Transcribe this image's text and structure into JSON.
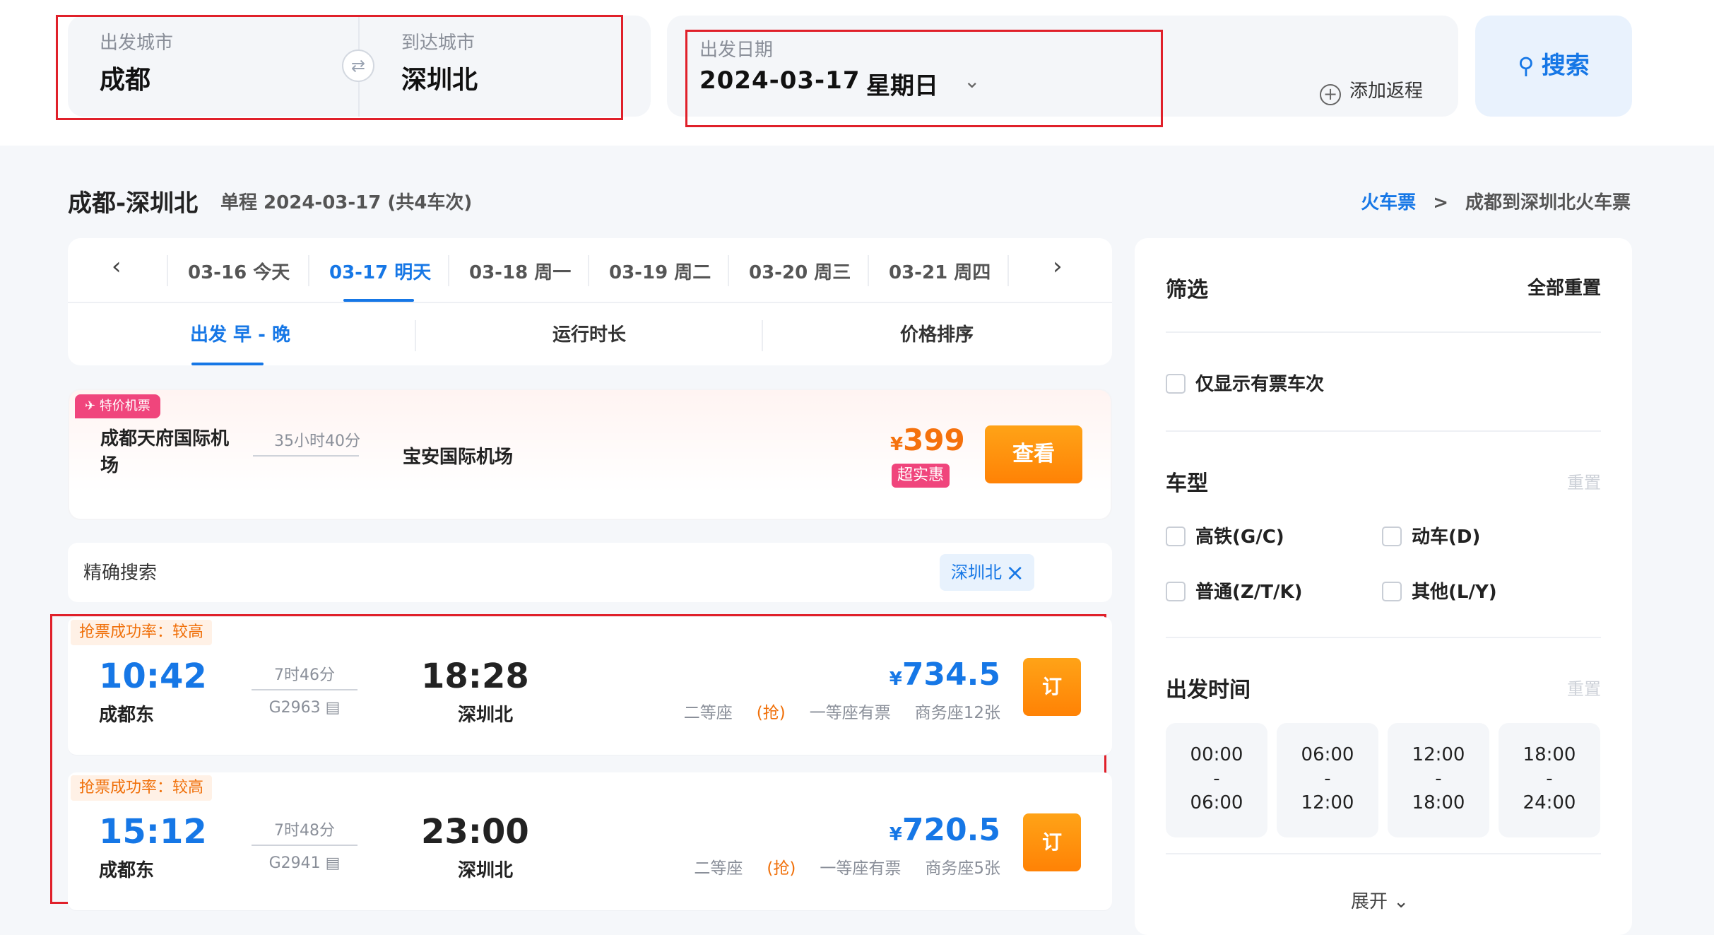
{
  "search": {
    "from_label": "出发城市",
    "from_city": "成都",
    "to_label": "到达城市",
    "to_city": "深圳北",
    "swap_icon": "⇄",
    "date_label": "出发日期",
    "date": "2024-03-17",
    "weekday": "星期日",
    "add_return": "添加返程",
    "button": "搜索"
  },
  "header": {
    "route": "成都-深圳北",
    "summary": "单程 2024-03-17 (共4车次)",
    "breadcrumb_link": "火车票",
    "breadcrumb_sep": ">",
    "breadcrumb_current": "成都到深圳北火车票"
  },
  "date_tabs": [
    {
      "label": "03-16 今天"
    },
    {
      "label": "03-17 明天",
      "active": true
    },
    {
      "label": "03-18 周一"
    },
    {
      "label": "03-19 周二"
    },
    {
      "label": "03-20 周三"
    },
    {
      "label": "03-21 周四"
    }
  ],
  "sort_tabs": [
    {
      "label": "出发 早 - 晚",
      "active": true
    },
    {
      "label": "运行时长"
    },
    {
      "label": "价格排序"
    }
  ],
  "flight": {
    "tag": "特价机票",
    "from": "成都天府国际机场",
    "duration": "35小时40分",
    "to": "宝安国际机场",
    "currency": "¥",
    "price": "399",
    "badge": "超实惠",
    "button": "查看"
  },
  "precise": {
    "label": "精确搜索",
    "chip": "深圳北"
  },
  "trains": [
    {
      "rate": "抢票成功率：较高",
      "dep_time": "10:42",
      "dep_station": "成都东",
      "duration": "7时46分",
      "train_no": "G2963",
      "arr_time": "18:28",
      "arr_station": "深圳北",
      "currency": "¥",
      "price": "734.5",
      "seat1": "二等座",
      "seat1_status": "(抢)",
      "seat2": "一等座有票",
      "seat3": "商务座12张",
      "book": "订"
    },
    {
      "rate": "抢票成功率：较高",
      "dep_time": "15:12",
      "dep_station": "成都东",
      "duration": "7时48分",
      "train_no": "G2941",
      "arr_time": "23:00",
      "arr_station": "深圳北",
      "currency": "¥",
      "price": "720.5",
      "seat1": "二等座",
      "seat1_status": "(抢)",
      "seat2": "一等座有票",
      "seat3": "商务座5张",
      "book": "订"
    }
  ],
  "filter": {
    "title": "筛选",
    "reset_all": "全部重置",
    "only_available": "仅显示有票车次",
    "train_type_title": "车型",
    "reset": "重置",
    "types": [
      "高铁(G/C)",
      "动车(D)",
      "普通(Z/T/K)",
      "其他(L/Y)"
    ],
    "dep_time_title": "出发时间",
    "time_slots": [
      {
        "start": "00:00",
        "dash": "-",
        "end": "06:00"
      },
      {
        "start": "06:00",
        "dash": "-",
        "end": "12:00"
      },
      {
        "start": "12:00",
        "dash": "-",
        "end": "18:00"
      },
      {
        "start": "18:00",
        "dash": "-",
        "end": "24:00"
      }
    ],
    "expand": "展开"
  },
  "colors": {
    "accent": "#1677e6",
    "orange": "#ff8a0a",
    "annotation_red": "#e0202a"
  }
}
